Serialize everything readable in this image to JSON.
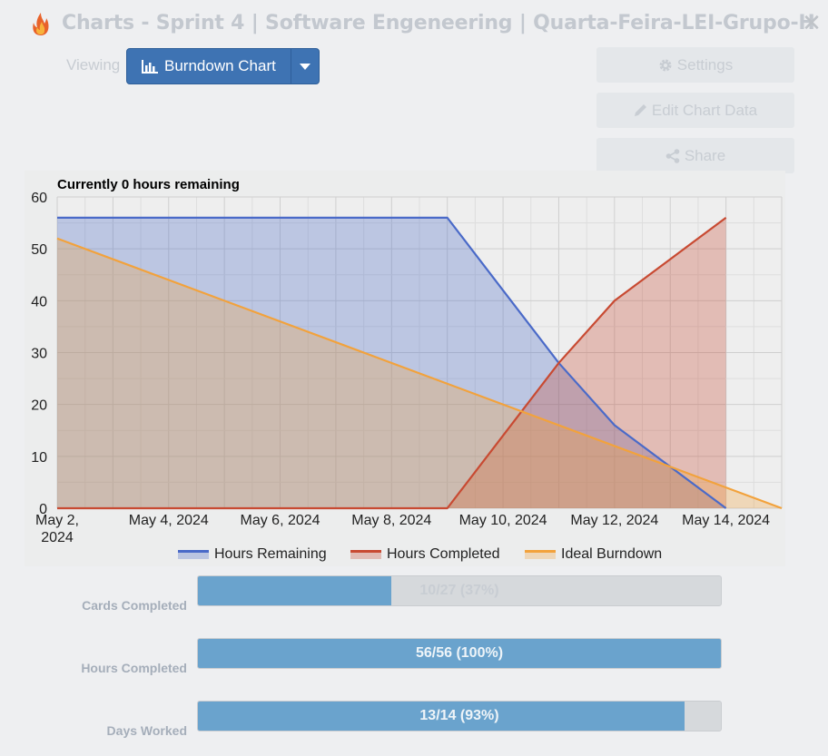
{
  "window": {
    "title": "Charts - Sprint 4 | Software Engeneering | Quarta-Feira-LEI-Grupo-H",
    "close_symbol": "✕",
    "app_icon": "flame-icon"
  },
  "toolbar": {
    "viewing_label": "Viewing",
    "chart_selector_label": "Burndown Chart",
    "chart_selector_icon": "bar-chart-icon",
    "settings_label": "Settings",
    "edit_label": "Edit Chart Data",
    "share_label": "Share"
  },
  "chart_data": {
    "type": "area",
    "title": "Currently 0 hours remaining",
    "xlabel": "",
    "ylabel": "",
    "ylim": [
      0,
      60
    ],
    "yticks": [
      0,
      10,
      20,
      30,
      40,
      50,
      60
    ],
    "xlim": [
      "2024-05-02",
      "2024-05-15"
    ],
    "xtick_labels": [
      "May 2, 2024",
      "May 4, 2024",
      "May 6, 2024",
      "May 8, 2024",
      "May 10, 2024",
      "May 12, 2024",
      "May 14, 2024"
    ],
    "grid": true,
    "legend_position": "bottom",
    "series": [
      {
        "name": "Hours Remaining",
        "color": "#4a6ac8",
        "x": [
          "2024-05-02",
          "2024-05-03",
          "2024-05-04",
          "2024-05-05",
          "2024-05-06",
          "2024-05-07",
          "2024-05-08",
          "2024-05-09",
          "2024-05-10",
          "2024-05-11",
          "2024-05-12",
          "2024-05-13",
          "2024-05-14"
        ],
        "y": [
          56,
          56,
          56,
          56,
          56,
          56,
          56,
          56,
          42,
          28,
          16,
          8,
          0
        ]
      },
      {
        "name": "Hours Completed",
        "color": "#c84a32",
        "x": [
          "2024-05-02",
          "2024-05-03",
          "2024-05-04",
          "2024-05-05",
          "2024-05-06",
          "2024-05-07",
          "2024-05-08",
          "2024-05-09",
          "2024-05-10",
          "2024-05-11",
          "2024-05-12",
          "2024-05-13",
          "2024-05-14"
        ],
        "y": [
          0,
          0,
          0,
          0,
          0,
          0,
          0,
          0,
          14,
          28,
          40,
          48,
          56
        ]
      },
      {
        "name": "Ideal Burndown",
        "color": "#f2a23c",
        "x": [
          "2024-05-02",
          "2024-05-15"
        ],
        "y": [
          52,
          0
        ]
      }
    ]
  },
  "stats": [
    {
      "label": "Cards Completed",
      "text": "10/27 (37%)",
      "fraction": 0.37
    },
    {
      "label": "Hours Completed",
      "text": "56/56 (100%)",
      "fraction": 1.0
    },
    {
      "label": "Days Worked",
      "text": "13/14 (93%)",
      "fraction": 0.93
    }
  ]
}
